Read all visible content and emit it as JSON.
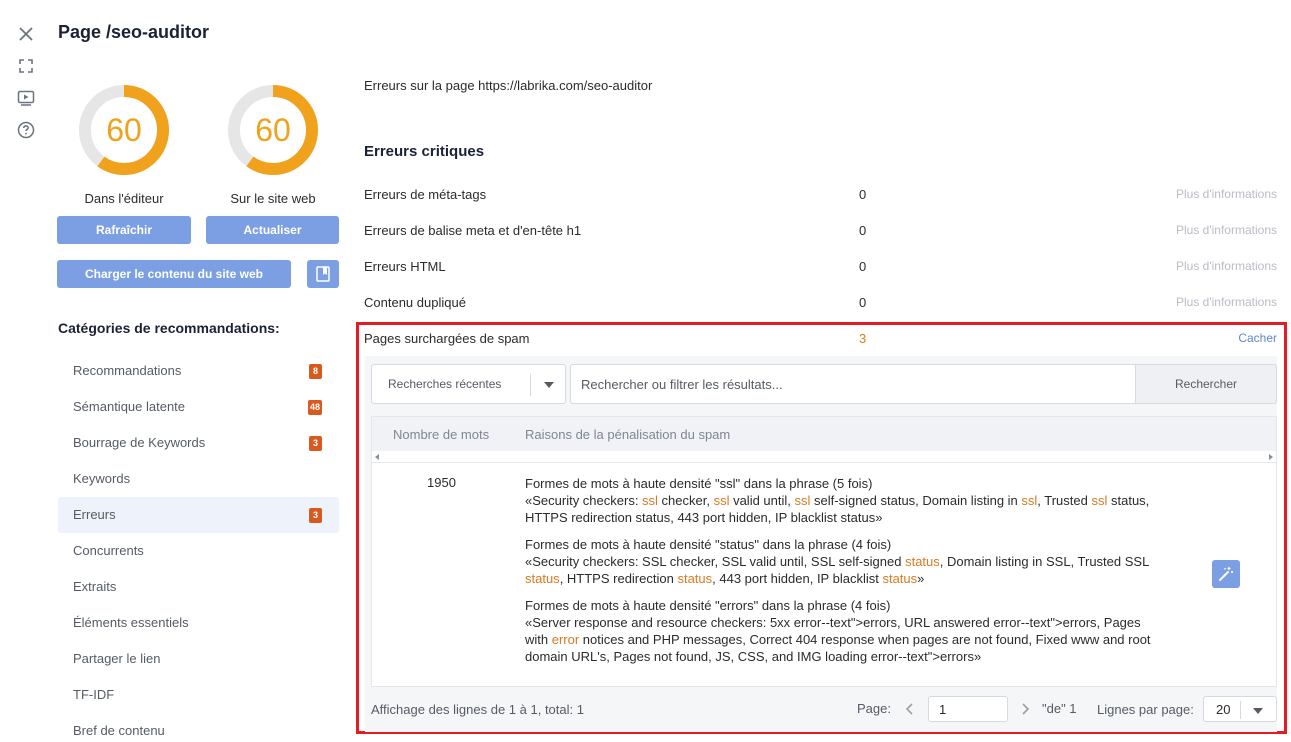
{
  "header": {
    "title": "Page /seo-auditor"
  },
  "scores": [
    {
      "value": "60",
      "label": "Dans l'éditeur",
      "fraction": 0.6
    },
    {
      "value": "60",
      "label": "Sur le site web",
      "fraction": 0.6
    }
  ],
  "buttons": {
    "refresh": "Rafraîchir",
    "update": "Actualiser",
    "load_content": "Charger le contenu du site web"
  },
  "categories": {
    "title": "Catégories de recommandations:",
    "items": [
      {
        "label": "Recommandations",
        "badge": "8"
      },
      {
        "label": "Sémantique latente",
        "badge": "48"
      },
      {
        "label": "Bourrage de Keywords",
        "badge": "3"
      },
      {
        "label": "Keywords",
        "badge": ""
      },
      {
        "label": "Erreurs",
        "badge": "3"
      },
      {
        "label": "Concurrents",
        "badge": ""
      },
      {
        "label": "Extraits",
        "badge": ""
      },
      {
        "label": "Éléments essentiels",
        "badge": ""
      },
      {
        "label": "Partager le lien",
        "badge": ""
      },
      {
        "label": "TF-IDF",
        "badge": ""
      },
      {
        "label": "Bref de contenu",
        "badge": ""
      }
    ]
  },
  "main": {
    "errors_on_page": "Erreurs sur la page https://labrika.com/seo-auditor",
    "critical_title": "Erreurs critiques",
    "more_info": "Plus d'informations",
    "hide": "Cacher",
    "rows": [
      {
        "label": "Erreurs de méta-tags",
        "count": "0"
      },
      {
        "label": "Erreurs de balise meta et d'en-tête h1",
        "count": "0"
      },
      {
        "label": "Erreurs HTML",
        "count": "0"
      },
      {
        "label": "Contenu dupliqué",
        "count": "0"
      },
      {
        "label": "Pages surchargées de spam",
        "count": "3"
      }
    ]
  },
  "filter": {
    "recent": "Recherches récentes",
    "search_placeholder": "Rechercher ou filtrer les résultats...",
    "search_button": "Rechercher"
  },
  "table": {
    "col_words": "Nombre de mots",
    "col_reasons": "Raisons de la pénalisation du spam",
    "row": {
      "words": "1950",
      "reasons": [
        {
          "title": "Formes de mots à haute densité \"ssl\" dans la phrase (5 fois)",
          "parts": [
            "«Security checkers: ",
            "ssl",
            " checker, ",
            "ssl",
            " valid until, ",
            "ssl",
            " self-signed status, Domain listing in ",
            "ssl",
            ", Trusted ",
            "ssl",
            " status, HTTPS redirection status, 443 port hidden, IP blacklist status»"
          ]
        },
        {
          "title": "Formes de mots à haute densité \"status\" dans la phrase (4 fois)",
          "parts": [
            "«Security checkers: SSL checker, SSL valid until, SSL self-signed ",
            "status",
            ", Domain listing in SSL, Trusted SSL ",
            "status",
            ", HTTPS redirection ",
            "status",
            ", 443 port hidden, IP blacklist ",
            "status",
            "»"
          ]
        },
        {
          "title": "Formes de mots à haute densité \"errors\" dans la phrase (4 fois)",
          "parts": [
            "«Server response and resource checkers: 5xx error--text\">errors, URL answered error--text\">errors, Pages with ",
            "error",
            " notices and PHP messages, Correct 404 response when pages are not found, Fixed www and root domain URL's, Pages not found, JS, CSS, and IMG loading error--text\">errors»"
          ]
        }
      ]
    }
  },
  "footer": {
    "info": "Affichage des lignes de 1 à 1, total: 1",
    "page_label": "Page:",
    "page_value": "1",
    "of": "\"de\" 1",
    "rows_label": "Lignes par page:",
    "rows_value": "20"
  },
  "colors": {
    "accent": "#7b9fe2",
    "score": "#f0a21c",
    "warn": "#d97a1f",
    "badge": "#d95a1f",
    "highlight": "#e31b23"
  }
}
